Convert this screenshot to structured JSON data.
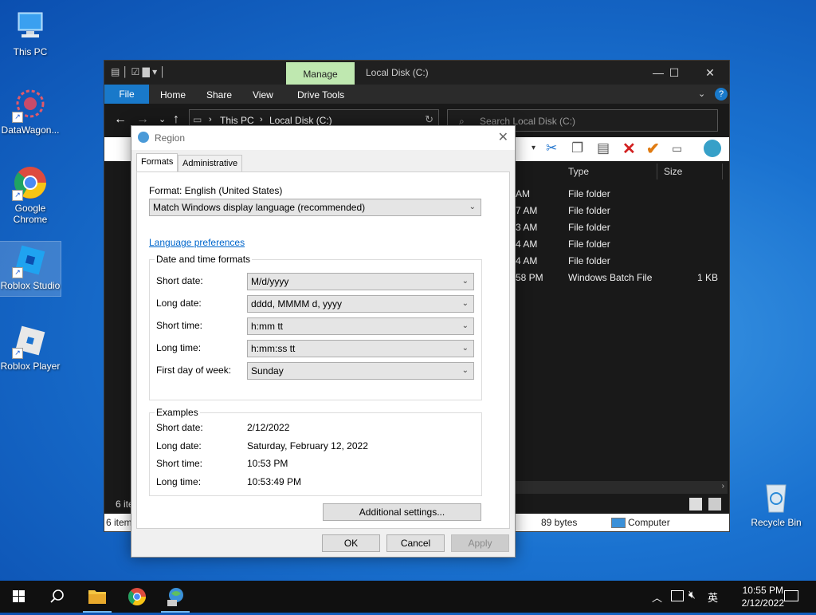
{
  "desktop": {
    "icons": [
      {
        "label": "This PC"
      },
      {
        "label": "DataWagon..."
      },
      {
        "label": "Google Chrome"
      },
      {
        "label": "Roblox Studio"
      },
      {
        "label": "Roblox Player"
      },
      {
        "label": "Recycle Bin"
      }
    ]
  },
  "explorer": {
    "manage_tab": "Manage",
    "title": "Local Disk (C:)",
    "ribbon_tabs": [
      "File",
      "Home",
      "Share",
      "View",
      "Drive Tools"
    ],
    "breadcrumb": [
      "This PC",
      "Local Disk (C:)"
    ],
    "search_placeholder": "Search Local Disk (C:)",
    "columns": {
      "type": "Type",
      "size": "Size"
    },
    "rows": [
      {
        "time": "AM",
        "type": "File folder",
        "size": ""
      },
      {
        "time": "7 AM",
        "type": "File folder",
        "size": ""
      },
      {
        "time": "3 AM",
        "type": "File folder",
        "size": ""
      },
      {
        "time": "4 AM",
        "type": "File folder",
        "size": ""
      },
      {
        "time": "4 AM",
        "type": "File folder",
        "size": ""
      },
      {
        "time": "58 PM",
        "type": "Windows Batch File",
        "size": "1 KB"
      }
    ],
    "status_left_inner": "6 ite",
    "status_left": "6 item",
    "status_bytes": "89 bytes",
    "status_computer": "Computer"
  },
  "region": {
    "title": "Region",
    "tabs": [
      "Formats",
      "Administrative"
    ],
    "format_label": "Format: English (United States)",
    "format_value": "Match Windows display language (recommended)",
    "language_link": "Language preferences",
    "datetime_group": "Date and time formats",
    "fields": [
      {
        "label": "Short date:",
        "value": "M/d/yyyy"
      },
      {
        "label": "Long date:",
        "value": "dddd, MMMM d, yyyy"
      },
      {
        "label": "Short time:",
        "value": "h:mm tt"
      },
      {
        "label": "Long time:",
        "value": "h:mm:ss tt"
      },
      {
        "label": "First day of week:",
        "value": "Sunday"
      }
    ],
    "examples_group": "Examples",
    "examples": [
      {
        "label": "Short date:",
        "value": "2/12/2022"
      },
      {
        "label": "Long date:",
        "value": "Saturday, February 12, 2022"
      },
      {
        "label": "Short time:",
        "value": "10:53 PM"
      },
      {
        "label": "Long time:",
        "value": "10:53:49 PM"
      }
    ],
    "additional_settings": "Additional settings...",
    "ok": "OK",
    "cancel": "Cancel",
    "apply": "Apply"
  },
  "taskbar": {
    "ime": "英",
    "time": "10:55 PM",
    "date": "2/12/2022"
  }
}
